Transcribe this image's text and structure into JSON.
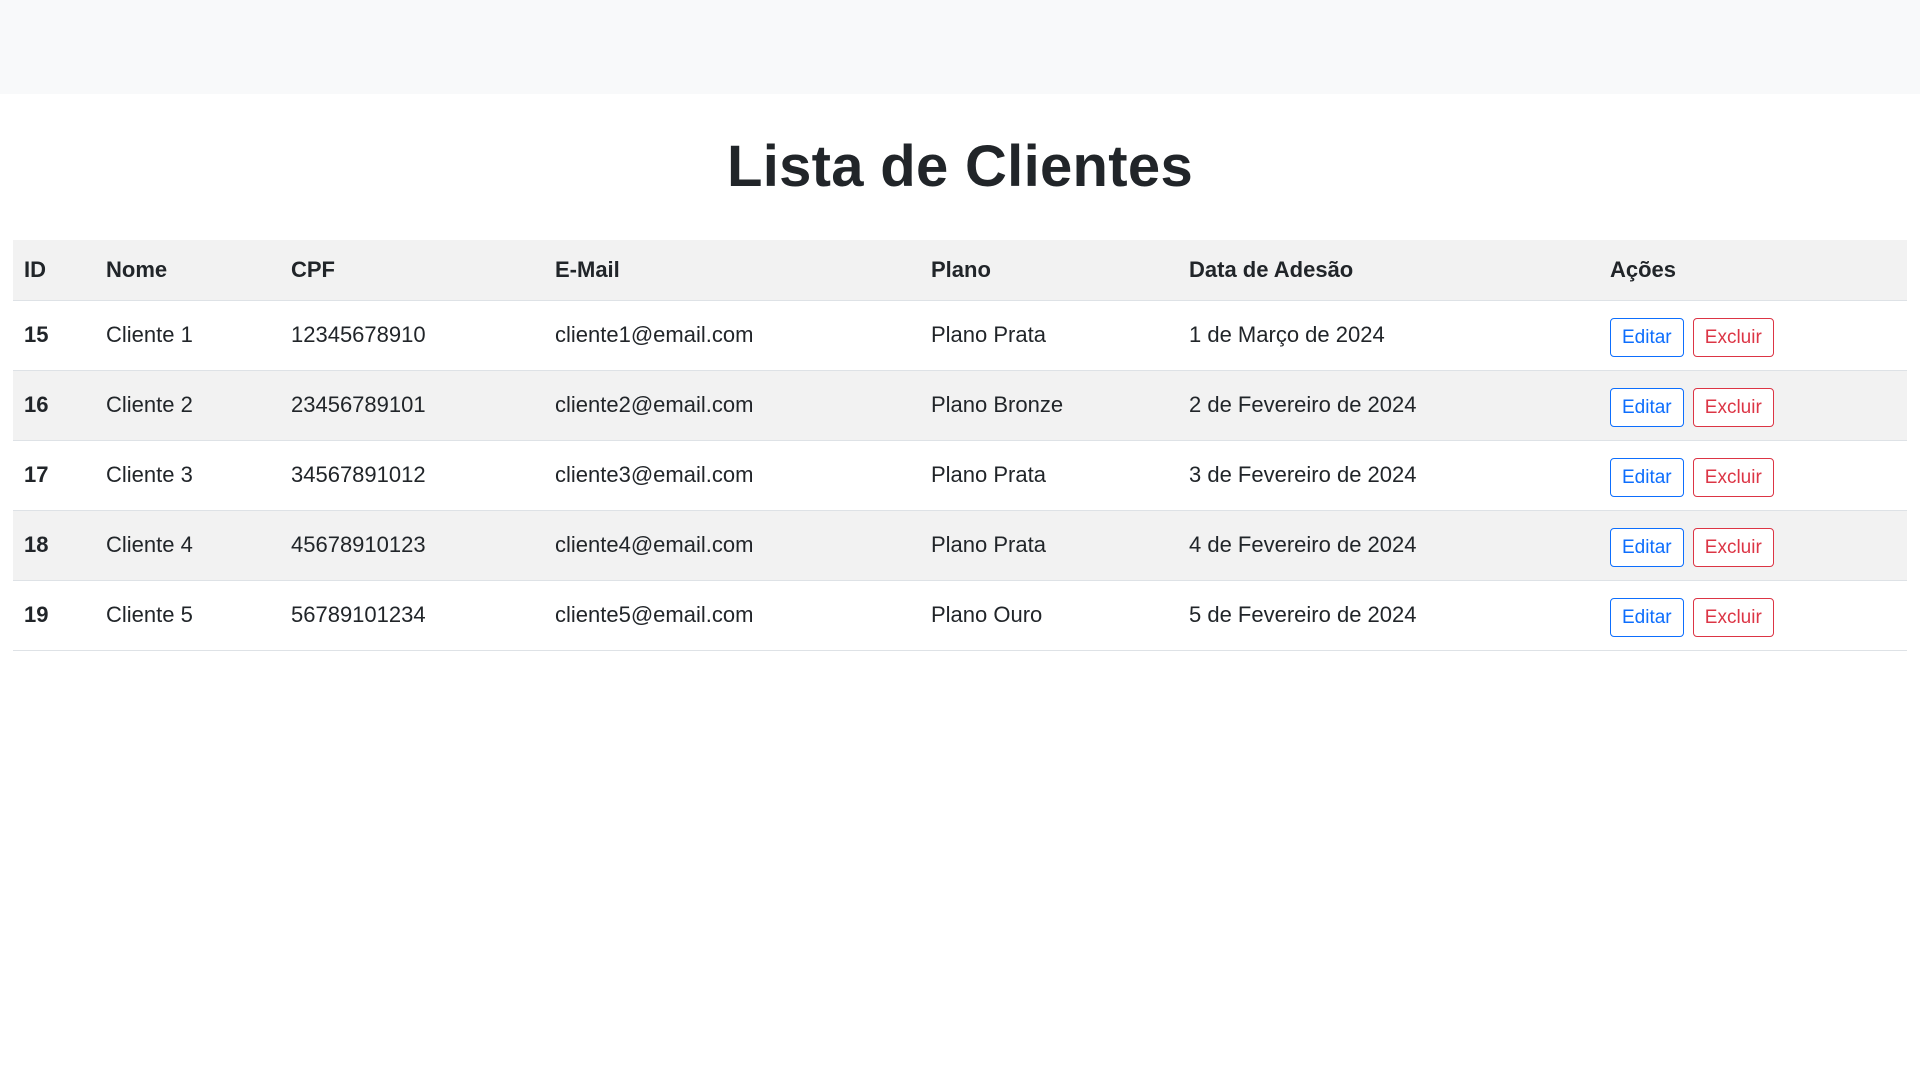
{
  "page": {
    "title": "Lista de Clientes"
  },
  "table": {
    "headers": [
      "ID",
      "Nome",
      "CPF",
      "E-Mail",
      "Plano",
      "Data de Adesão",
      "Ações"
    ],
    "rows": [
      {
        "id": "15",
        "nome": "Cliente 1",
        "cpf": "12345678910",
        "email": "cliente1@email.com",
        "plano": "Plano Prata",
        "data": "1 de Março de 2024"
      },
      {
        "id": "16",
        "nome": "Cliente 2",
        "cpf": "23456789101",
        "email": "cliente2@email.com",
        "plano": "Plano Bronze",
        "data": "2 de Fevereiro de 2024"
      },
      {
        "id": "17",
        "nome": "Cliente 3",
        "cpf": "34567891012",
        "email": "cliente3@email.com",
        "plano": "Plano Prata",
        "data": "3 de Fevereiro de 2024"
      },
      {
        "id": "18",
        "nome": "Cliente 4",
        "cpf": "45678910123",
        "email": "cliente4@email.com",
        "plano": "Plano Prata",
        "data": "4 de Fevereiro de 2024"
      },
      {
        "id": "19",
        "nome": "Cliente 5",
        "cpf": "56789101234",
        "email": "cliente5@email.com",
        "plano": "Plano Ouro",
        "data": "5 de Fevereiro de 2024"
      }
    ],
    "edit_label": "Editar",
    "delete_label": "Excluir"
  },
  "colors": {
    "navbar_bg": "#f8f9fa",
    "edit": "#0d6efd",
    "delete": "#dc3545",
    "stripe": "#f2f2f2"
  }
}
